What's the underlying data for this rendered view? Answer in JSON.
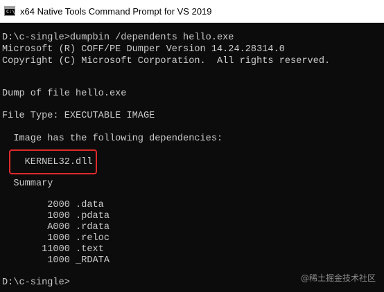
{
  "window": {
    "title": "x64 Native Tools Command Prompt for VS 2019",
    "icon": "console-icon",
    "icon_prompt": "C:\\"
  },
  "console": {
    "lines": [
      "D:\\c-single>dumpbin /dependents hello.exe",
      "Microsoft (R) COFF/PE Dumper Version 14.24.28314.0",
      "Copyright (C) Microsoft Corporation.  All rights reserved.",
      "Dump of file hello.exe",
      "File Type: EXECUTABLE IMAGE",
      "  Image has the following dependencies:",
      "    KERNEL32.dll",
      "  Summary",
      "        2000 .data",
      "        1000 .pdata",
      "        A000 .rdata",
      "        1000 .reloc",
      "       11000 .text",
      "        1000 _RDATA",
      "D:\\c-single>"
    ]
  },
  "highlight": {
    "color": "#e02a2a",
    "target": "KERNEL32.dll"
  },
  "watermark": "@稀土掘金技术社区"
}
